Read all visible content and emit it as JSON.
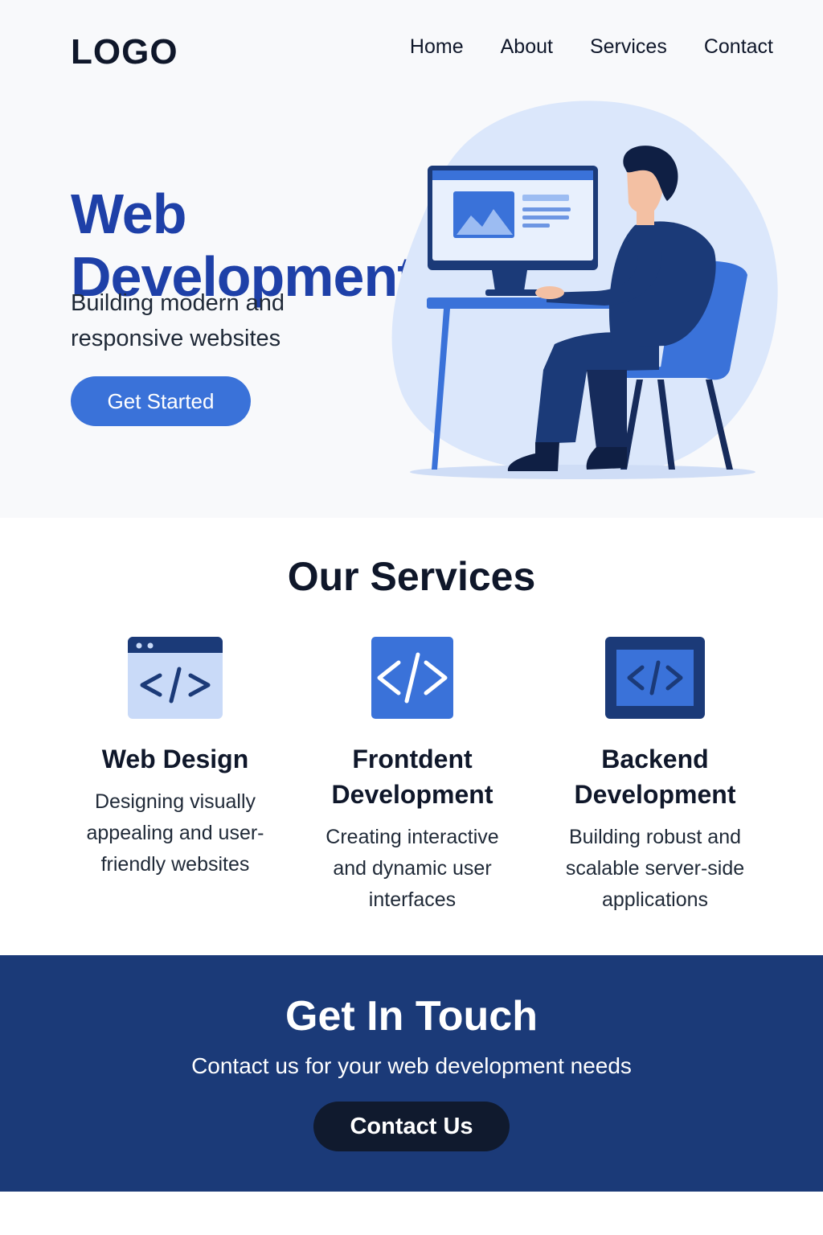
{
  "header": {
    "logo": "LOGO",
    "nav": [
      "Home",
      "About",
      "Services",
      "Contact"
    ]
  },
  "hero": {
    "title_line1": "Web",
    "title_line2": "Development",
    "subtitle": "Building modern and responsive websites",
    "cta": "Get Started",
    "illustration": "developer-at-desk-illustration"
  },
  "services": {
    "title": "Our Services",
    "items": [
      {
        "title": "Web Design",
        "description": "Designing visually appealing and user-friendly websites",
        "icon": "browser-code-icon"
      },
      {
        "title": "Frontdent Development",
        "description": "Creating interactive and dynamic user interfaces",
        "icon": "code-icon"
      },
      {
        "title": "Backend Development",
        "description": "Building robust and scalable server-side applications",
        "icon": "server-code-icon"
      }
    ]
  },
  "contact": {
    "title": "Get In Touch",
    "subtitle": "Contact us for your web development needs",
    "cta": "Contact Us"
  },
  "colors": {
    "primary": "#1e40a8",
    "accent": "#3a72d9",
    "dark_navy": "#1b3a78",
    "button_dark": "#101a2e"
  }
}
